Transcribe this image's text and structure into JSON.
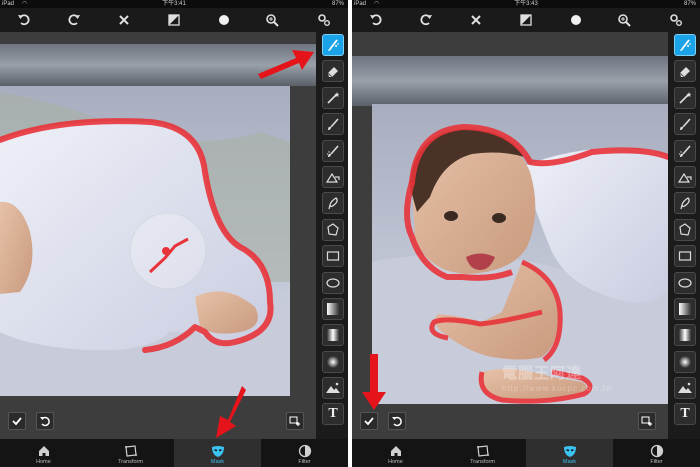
{
  "left_screen": {
    "status": {
      "carrier": "iPad",
      "time": "下午3:41",
      "battery": "87%"
    },
    "tabs": [
      {
        "label": "Home",
        "icon": "home-icon",
        "active": false
      },
      {
        "label": "Transform",
        "icon": "transform-icon",
        "active": false
      },
      {
        "label": "Mask",
        "icon": "mask-icon",
        "active": true
      },
      {
        "label": "Filter",
        "icon": "filter-icon",
        "active": false
      }
    ]
  },
  "right_screen": {
    "status": {
      "carrier": "iPad",
      "time": "下午3:43",
      "battery": "87%"
    },
    "tabs": [
      {
        "label": "Home",
        "icon": "home-icon",
        "active": false
      },
      {
        "label": "Transform",
        "icon": "transform-icon",
        "active": false
      },
      {
        "label": "Mask",
        "icon": "mask-icon",
        "active": true
      },
      {
        "label": "Filter",
        "icon": "filter-icon",
        "active": false
      }
    ]
  },
  "toolbar_icons": [
    "undo-icon",
    "redo-icon",
    "close-icon",
    "invert-icon",
    "brush-size-icon",
    "zoom-icon",
    "settings-icon"
  ],
  "mask_tools": [
    "smart-brush-icon",
    "eraser-icon",
    "magic-wand-icon",
    "brush-icon",
    "feather-brush-icon",
    "paint-bucket-icon",
    "lasso-icon",
    "polygon-icon",
    "rectangle-icon",
    "ellipse-icon",
    "linear-gradient-icon",
    "mirror-gradient-icon",
    "radial-gradient-icon",
    "landscape-icon",
    "text-icon"
  ],
  "text_tool_glyph": "T",
  "watermark": {
    "text": "電腦王阿達",
    "subtext": "http://www.kocpc.com.tw"
  },
  "colors": {
    "accent": "#1aa3e8",
    "mask_stroke": "#e8333a",
    "arrow": "#e5141a"
  }
}
